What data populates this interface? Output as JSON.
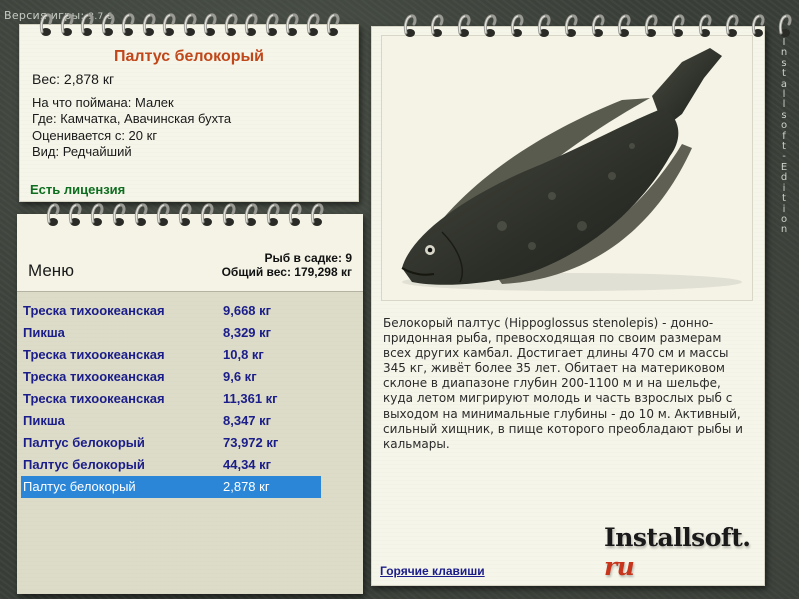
{
  "version": {
    "label": "Версия игры:",
    "number": "3.7.6"
  },
  "side_edition": [
    "I",
    "n",
    "s",
    "t",
    "a",
    "l",
    "l",
    "s",
    "o",
    "f",
    "t",
    "-",
    "E",
    "d",
    "i",
    "t",
    "i",
    "o",
    "n"
  ],
  "info": {
    "title": "Палтус белокорый",
    "weight": "Вес: 2,878 кг",
    "bait": "На что поймана: Малек",
    "location": "Где: Камчатка, Авачинская бухта",
    "value": "Оценивается с: 20 кг",
    "rarity": "Вид: Редчайший",
    "license": "Есть лицензия"
  },
  "notepad": {
    "menu_title": "Меню",
    "fish_count": "Рыб в садке: 9",
    "total_weight": "Общий вес: 179,298 кг",
    "items": [
      {
        "name": "Треска тихоокеанская",
        "weight": "9,668 кг"
      },
      {
        "name": "Пикша",
        "weight": "8,329 кг"
      },
      {
        "name": "Треска тихоокеанская",
        "weight": "10,8 кг"
      },
      {
        "name": "Треска тихоокеанская",
        "weight": "9,6 кг"
      },
      {
        "name": "Треска тихоокеанская",
        "weight": "11,361 кг"
      },
      {
        "name": "Пикша",
        "weight": "8,347 кг"
      },
      {
        "name": "Палтус белокорый",
        "weight": "73,972 кг"
      },
      {
        "name": "Палтус белокорый",
        "weight": "44,34 кг"
      },
      {
        "name": "Палтус белокорый",
        "weight": "2,878 кг"
      }
    ],
    "selected_index": 8
  },
  "fishcard": {
    "description": "Белокорый палтус (Hippoglossus stenolepis) - донно-придонная рыба, превосходящая по своим размерам всех других камбал. Достигает длины 470 см и массы 345 кг, живёт более 35 лет. Обитает на материковом склоне в диапазоне глубин 200-1100 м и на шельфе, куда летом мигрируют молодь и часть взрослых рыб с выходом на минимальные глубины - до 10 м. Активный, сильный хищник, в пище которого преобладают рыбы и кальмары.",
    "logo_main": "Installsoft.",
    "logo_tld": "ru",
    "hotkeys_link": "Горячие клавиши"
  },
  "colors": {
    "title_orange": "#c0471a",
    "license_green": "#0e6e20",
    "list_blue": "#1b1d8a",
    "selection_blue": "#2b86d8",
    "paper": "#f6f5e9",
    "background": "#3a3f39"
  },
  "icons": {
    "spiral_ring": "spiral-ring-icon",
    "fish_picture": "halibut-illustration"
  }
}
